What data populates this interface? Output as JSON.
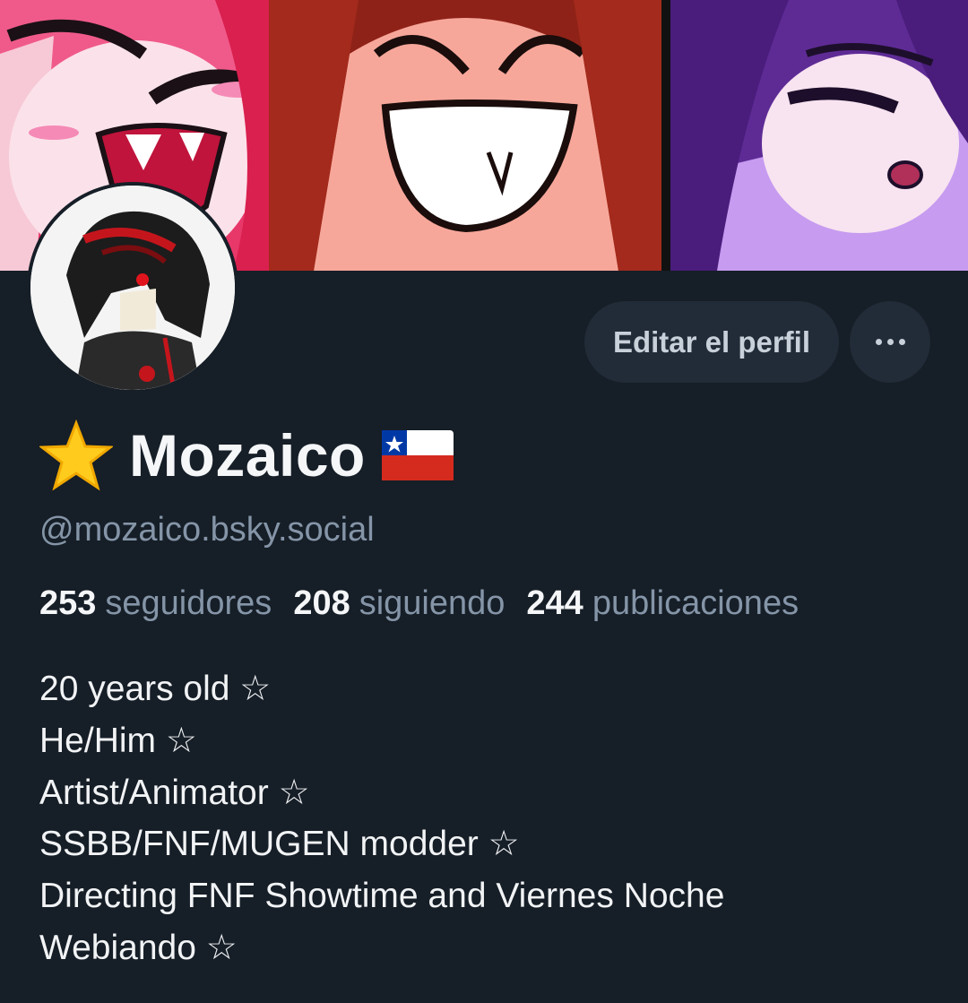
{
  "profile": {
    "display_name": "Mozaico",
    "name_prefix_icon": "star-emoji",
    "name_suffix_icon": "chile-flag-emoji",
    "handle": "@mozaico.bsky.social",
    "edit_label": "Editar el perfil",
    "more_label": "more-options",
    "stats": {
      "followers_count": "253",
      "followers_label": "seguidores",
      "following_count": "208",
      "following_label": "siguiendo",
      "posts_count": "244",
      "posts_label": "publicaciones"
    },
    "bio": [
      "20 years old ☆",
      "He/Him ☆",
      "Artist/Animator ☆",
      "SSBB/FNF/MUGEN modder ☆",
      "Directing FNF Showtime and Viernes Noche",
      "Webiando ☆"
    ]
  },
  "colors": {
    "background": "#161e27",
    "button_bg": "#212c38",
    "muted_text": "#8595a8",
    "primary_text": "#f4f6f8"
  }
}
